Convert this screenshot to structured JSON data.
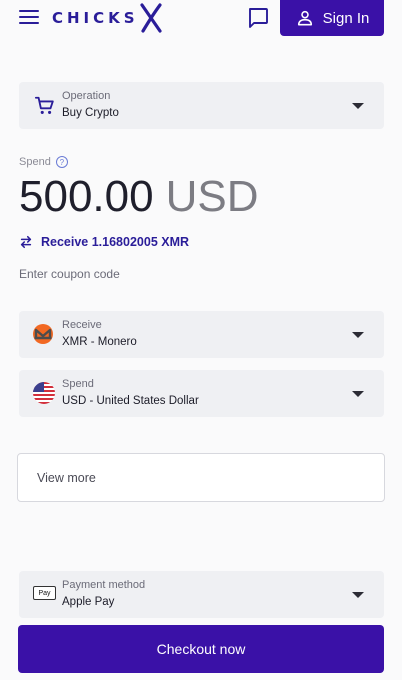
{
  "header": {
    "logo_text": "CHICKS",
    "signin_label": "Sign In",
    "colors": {
      "brand": "#2a1d99",
      "primary_button": "#3a11a7"
    }
  },
  "operation": {
    "label": "Operation",
    "value": "Buy Crypto",
    "icon": "cart-icon"
  },
  "spend_amount": {
    "label": "Spend",
    "amount": "500.00",
    "currency": "USD"
  },
  "receive_line": {
    "text": "Receive 1.16802005 XMR"
  },
  "coupon": {
    "text": "Enter coupon code"
  },
  "receive_select": {
    "label": "Receive",
    "value": "XMR - Monero",
    "icon": "monero-icon",
    "icon_color": "#f26822"
  },
  "spend_select": {
    "label": "Spend",
    "value": "USD - United States Dollar",
    "icon": "us-flag-icon"
  },
  "view_more": {
    "label": "View more"
  },
  "payment": {
    "label": "Payment method",
    "value": "Apple Pay",
    "icon": "apple-pay-icon",
    "icon_text": "Pay"
  },
  "checkout": {
    "label": "Checkout now"
  }
}
